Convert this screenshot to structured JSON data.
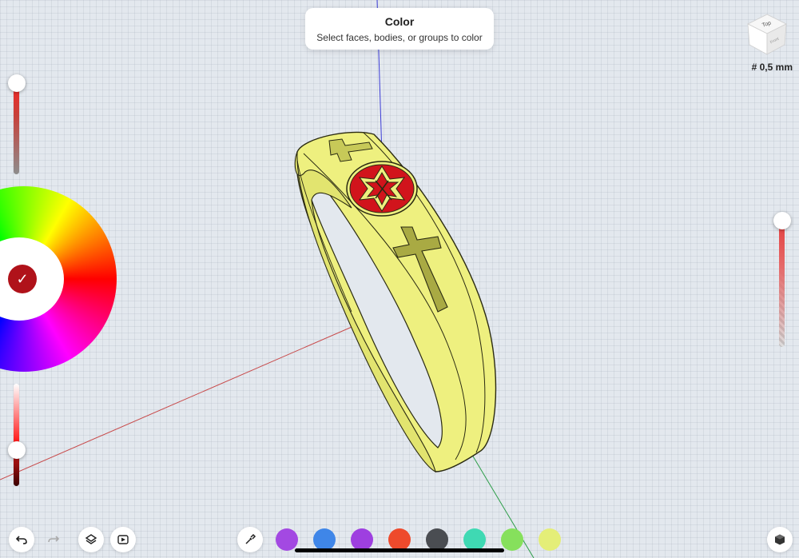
{
  "tooltip": {
    "title": "Color",
    "subtitle": "Select faces, bodies, or groups to color"
  },
  "view_cube": {
    "face_label": "Top",
    "side_label": "Front"
  },
  "grid": {
    "label": "# 0,5 mm"
  },
  "color_picker": {
    "selected_color": "#b0121a",
    "check_icon": "✓",
    "brightness_level": 1.0,
    "saturation_level": 0.3,
    "opacity_level": 1.0
  },
  "toolbar": {
    "undo_icon": "undo-icon",
    "redo_icon": "redo-icon",
    "layers_icon": "layers-icon",
    "play_icon": "play-icon",
    "eyedropper_icon": "eyedropper-icon",
    "view_mode_icon": "cube-icon"
  },
  "swatches": [
    {
      "name": "purple",
      "color": "#a349e2"
    },
    {
      "name": "blue",
      "color": "#3f86e8"
    },
    {
      "name": "violet",
      "color": "#9e3fe0"
    },
    {
      "name": "red-orange",
      "color": "#ee4a2c"
    },
    {
      "name": "dark-gray",
      "color": "#4a4d52"
    },
    {
      "name": "teal",
      "color": "#3fd9b3"
    },
    {
      "name": "light-green",
      "color": "#86e05c"
    },
    {
      "name": "pale-yellow",
      "color": "#e4ee78"
    }
  ],
  "model": {
    "body_color": "#eef07f",
    "emblem_color": "#d1141c"
  }
}
